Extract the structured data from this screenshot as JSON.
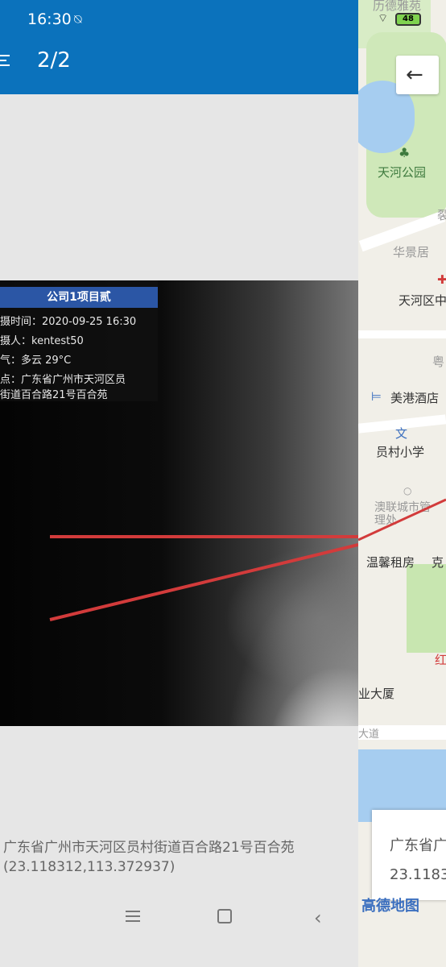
{
  "status_bar": {
    "time": "16:30",
    "alarm_icon": "alarm-off-icon",
    "battery": "48"
  },
  "header": {
    "counter": "2/2"
  },
  "photo_watermark": {
    "title": "公司1项目贰",
    "lines": [
      "摄时间：2020-09-25 16:30",
      "摄人：kentest50",
      "气：多云 29°C",
      "点：广东省广州市天河区员",
      "街道百合路21号百合苑"
    ]
  },
  "address": {
    "line1": "广东省广州市天河区员村街道百合路21号百合苑",
    "line2": "(23.118312,113.372937)"
  },
  "map": {
    "labels": {
      "top": "历德雅苑",
      "park": "天河公园",
      "area": "华景居",
      "hospital": "天河区中",
      "hotel": "美港酒店",
      "school": "员村小学",
      "office": "澳联城市管理处",
      "rent": "温馨租房",
      "building": "业大厦",
      "red": "红",
      "right1": "克",
      "right2": "粤",
      "right3": "裂",
      "road": "大道"
    },
    "back_icon": "arrow-left-icon",
    "info": {
      "line1": "广东省广",
      "line2": "23.1183"
    },
    "logo": "高德地图"
  },
  "colors": {
    "primary": "#0b72bc",
    "title_bg": "#2b56a5",
    "line": "#d23b3b"
  }
}
